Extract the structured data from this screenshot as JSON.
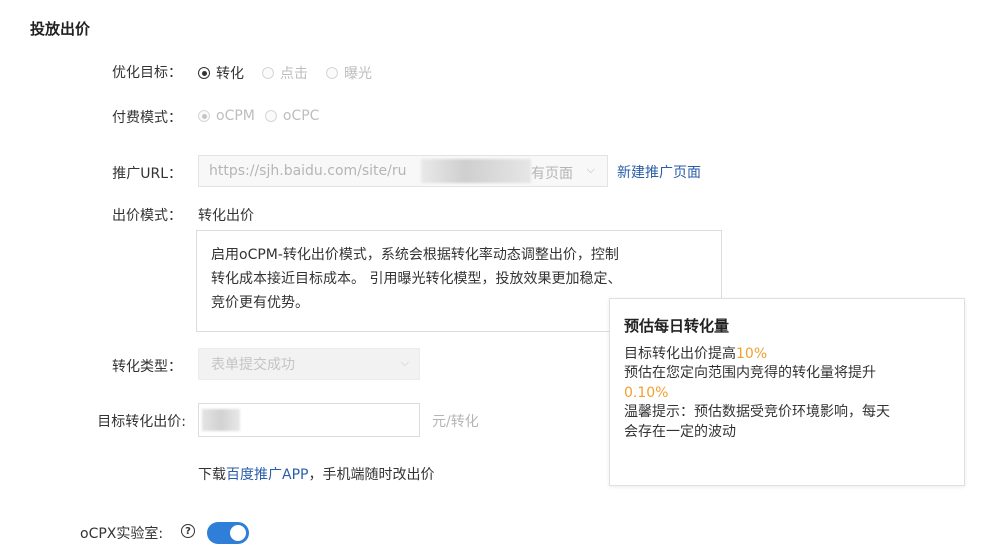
{
  "section_title": "投放出价",
  "optimization_target": {
    "label": "优化目标：",
    "options": [
      {
        "label": "转化",
        "checked": true,
        "disabled": false
      },
      {
        "label": "点击",
        "checked": false,
        "disabled": true
      },
      {
        "label": "曝光",
        "checked": false,
        "disabled": true
      }
    ]
  },
  "payment_mode": {
    "label": "付费模式：",
    "options": [
      {
        "label": "oCPM",
        "checked": true,
        "disabled": true
      },
      {
        "label": "oCPC",
        "checked": false,
        "disabled": true
      }
    ]
  },
  "promo_url": {
    "label": "推广URL：",
    "value_prefix": "https://sjh.baidu.com/site/ru",
    "value_suffix": "有页面",
    "new_page_link": "新建推广页面"
  },
  "bid_mode": {
    "label": "出价模式：",
    "value": "转化出价",
    "description_lines": [
      "启用oCPM-转化出价模式，系统会根据转化率动态调整出价，控制",
      "转化成本接近目标成本。 引用曝光转化模型，投放效果更加稳定、",
      "竞价更有优势。"
    ]
  },
  "conversion_type": {
    "label": "转化类型：",
    "value": "表单提交成功"
  },
  "target_bid": {
    "label": "目标转化出价:",
    "unit": "元/转化"
  },
  "download_hint": {
    "prefix": "下载",
    "link": "百度推广APP",
    "suffix": "，手机端随时改出价"
  },
  "tooltip": {
    "title": "预估每日转化量",
    "line1_prefix": "目标转化出价提高",
    "line1_value": "10%",
    "line2": "预估在您定向范围内竞得的转化量将提升",
    "line3_value": "0.10%",
    "line4": "温馨提示：预估数据受竞价环境影响，每天",
    "line5": "会存在一定的波动"
  },
  "ocpx_lab": {
    "label": "oCPX实验室:",
    "help_glyph": "?",
    "enabled": true
  },
  "colors": {
    "link": "#2b5ea8",
    "highlight": "#f0a030",
    "toggle_on": "#2f7fd8"
  }
}
